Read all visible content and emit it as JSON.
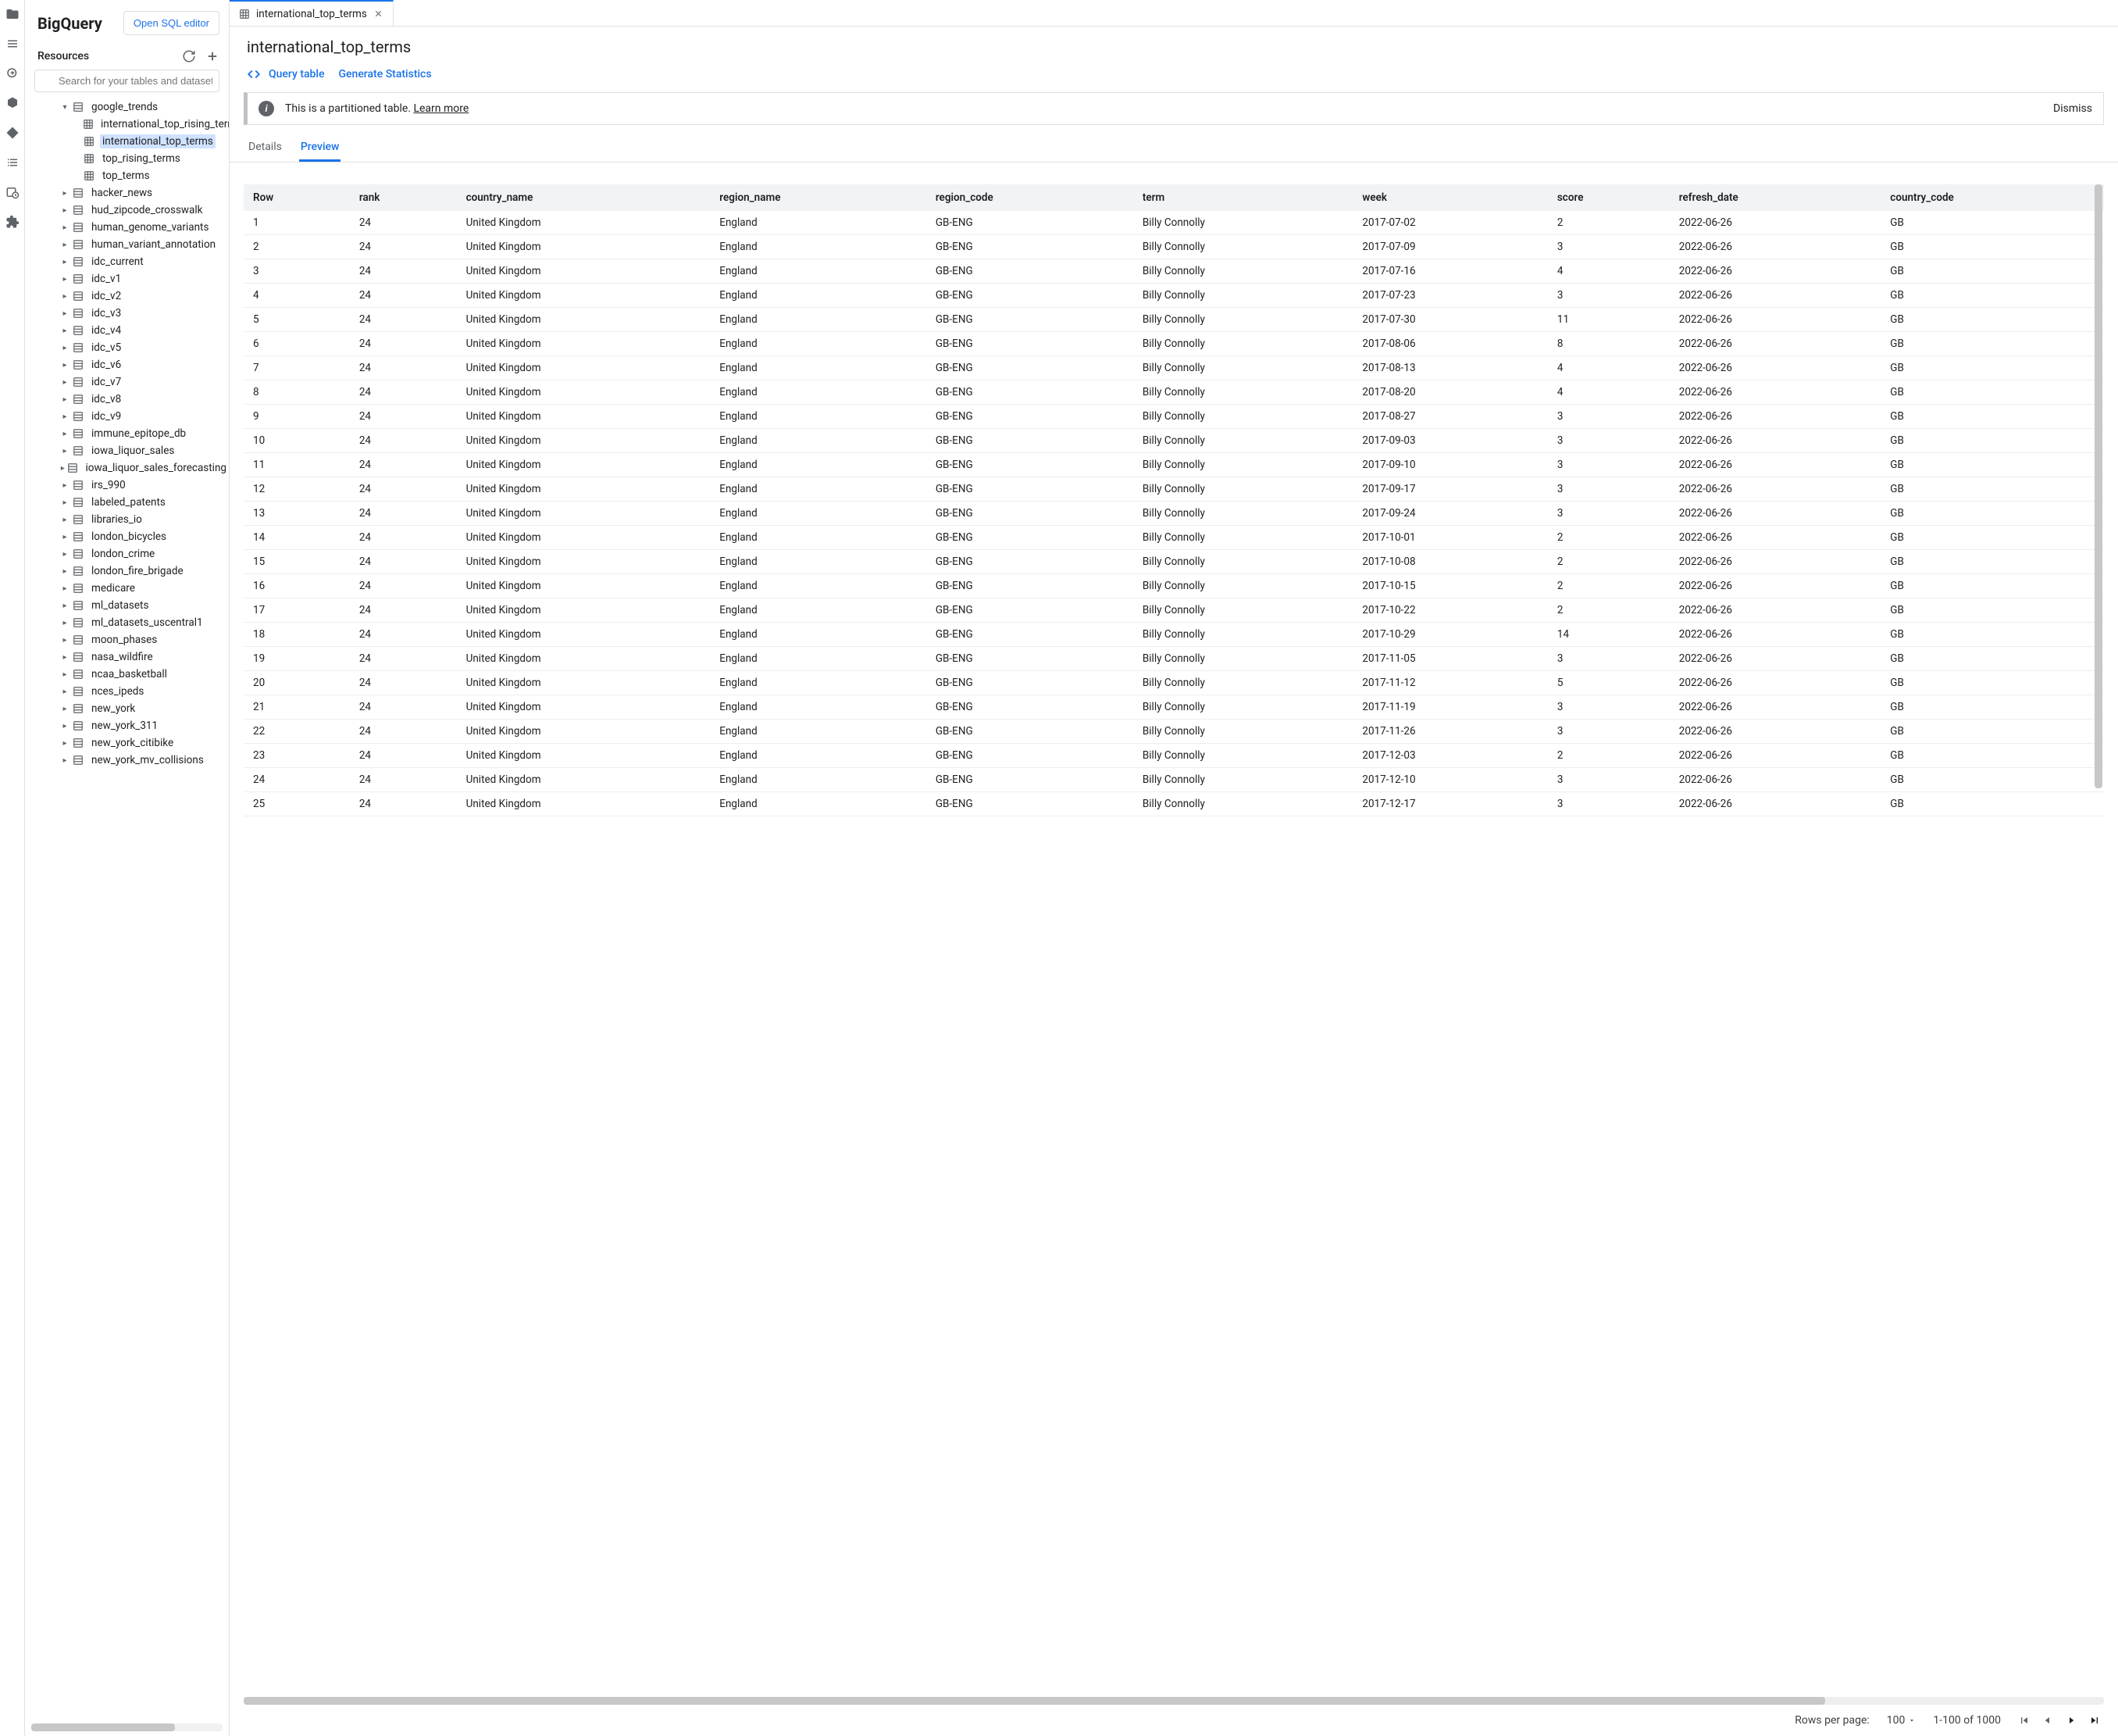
{
  "brand": "BigQuery",
  "open_sql_label": "Open SQL editor",
  "resources_label": "Resources",
  "search_placeholder": "Search for your tables and datasets",
  "tree": {
    "root": {
      "label": "google_trends",
      "children": [
        "international_top_rising_terms",
        "international_top_terms",
        "top_rising_terms",
        "top_terms"
      ],
      "selected_index": 1
    },
    "datasets": [
      "hacker_news",
      "hud_zipcode_crosswalk",
      "human_genome_variants",
      "human_variant_annotation",
      "idc_current",
      "idc_v1",
      "idc_v2",
      "idc_v3",
      "idc_v4",
      "idc_v5",
      "idc_v6",
      "idc_v7",
      "idc_v8",
      "idc_v9",
      "immune_epitope_db",
      "iowa_liquor_sales",
      "iowa_liquor_sales_forecasting",
      "irs_990",
      "labeled_patents",
      "libraries_io",
      "london_bicycles",
      "london_crime",
      "london_fire_brigade",
      "medicare",
      "ml_datasets",
      "ml_datasets_uscentral1",
      "moon_phases",
      "nasa_wildfire",
      "ncaa_basketball",
      "nces_ipeds",
      "new_york",
      "new_york_311",
      "new_york_citibike",
      "new_york_mv_collisions"
    ]
  },
  "tab": {
    "label": "international_top_terms"
  },
  "page_title": "international_top_terms",
  "actions": {
    "query_table": "Query table",
    "gen_stats": "Generate Statistics"
  },
  "banner": {
    "text": "This is a partitioned table. ",
    "link": "Learn more",
    "dismiss": "Dismiss"
  },
  "subtabs": {
    "details": "Details",
    "preview": "Preview"
  },
  "table": {
    "columns": [
      "Row",
      "rank",
      "country_name",
      "region_name",
      "region_code",
      "term",
      "week",
      "score",
      "refresh_date",
      "country_code"
    ],
    "rows": [
      [
        "1",
        "24",
        "United Kingdom",
        "England",
        "GB-ENG",
        "Billy Connolly",
        "2017-07-02",
        "2",
        "2022-06-26",
        "GB"
      ],
      [
        "2",
        "24",
        "United Kingdom",
        "England",
        "GB-ENG",
        "Billy Connolly",
        "2017-07-09",
        "3",
        "2022-06-26",
        "GB"
      ],
      [
        "3",
        "24",
        "United Kingdom",
        "England",
        "GB-ENG",
        "Billy Connolly",
        "2017-07-16",
        "4",
        "2022-06-26",
        "GB"
      ],
      [
        "4",
        "24",
        "United Kingdom",
        "England",
        "GB-ENG",
        "Billy Connolly",
        "2017-07-23",
        "3",
        "2022-06-26",
        "GB"
      ],
      [
        "5",
        "24",
        "United Kingdom",
        "England",
        "GB-ENG",
        "Billy Connolly",
        "2017-07-30",
        "11",
        "2022-06-26",
        "GB"
      ],
      [
        "6",
        "24",
        "United Kingdom",
        "England",
        "GB-ENG",
        "Billy Connolly",
        "2017-08-06",
        "8",
        "2022-06-26",
        "GB"
      ],
      [
        "7",
        "24",
        "United Kingdom",
        "England",
        "GB-ENG",
        "Billy Connolly",
        "2017-08-13",
        "4",
        "2022-06-26",
        "GB"
      ],
      [
        "8",
        "24",
        "United Kingdom",
        "England",
        "GB-ENG",
        "Billy Connolly",
        "2017-08-20",
        "4",
        "2022-06-26",
        "GB"
      ],
      [
        "9",
        "24",
        "United Kingdom",
        "England",
        "GB-ENG",
        "Billy Connolly",
        "2017-08-27",
        "3",
        "2022-06-26",
        "GB"
      ],
      [
        "10",
        "24",
        "United Kingdom",
        "England",
        "GB-ENG",
        "Billy Connolly",
        "2017-09-03",
        "3",
        "2022-06-26",
        "GB"
      ],
      [
        "11",
        "24",
        "United Kingdom",
        "England",
        "GB-ENG",
        "Billy Connolly",
        "2017-09-10",
        "3",
        "2022-06-26",
        "GB"
      ],
      [
        "12",
        "24",
        "United Kingdom",
        "England",
        "GB-ENG",
        "Billy Connolly",
        "2017-09-17",
        "3",
        "2022-06-26",
        "GB"
      ],
      [
        "13",
        "24",
        "United Kingdom",
        "England",
        "GB-ENG",
        "Billy Connolly",
        "2017-09-24",
        "3",
        "2022-06-26",
        "GB"
      ],
      [
        "14",
        "24",
        "United Kingdom",
        "England",
        "GB-ENG",
        "Billy Connolly",
        "2017-10-01",
        "2",
        "2022-06-26",
        "GB"
      ],
      [
        "15",
        "24",
        "United Kingdom",
        "England",
        "GB-ENG",
        "Billy Connolly",
        "2017-10-08",
        "2",
        "2022-06-26",
        "GB"
      ],
      [
        "16",
        "24",
        "United Kingdom",
        "England",
        "GB-ENG",
        "Billy Connolly",
        "2017-10-15",
        "2",
        "2022-06-26",
        "GB"
      ],
      [
        "17",
        "24",
        "United Kingdom",
        "England",
        "GB-ENG",
        "Billy Connolly",
        "2017-10-22",
        "2",
        "2022-06-26",
        "GB"
      ],
      [
        "18",
        "24",
        "United Kingdom",
        "England",
        "GB-ENG",
        "Billy Connolly",
        "2017-10-29",
        "14",
        "2022-06-26",
        "GB"
      ],
      [
        "19",
        "24",
        "United Kingdom",
        "England",
        "GB-ENG",
        "Billy Connolly",
        "2017-11-05",
        "3",
        "2022-06-26",
        "GB"
      ],
      [
        "20",
        "24",
        "United Kingdom",
        "England",
        "GB-ENG",
        "Billy Connolly",
        "2017-11-12",
        "5",
        "2022-06-26",
        "GB"
      ],
      [
        "21",
        "24",
        "United Kingdom",
        "England",
        "GB-ENG",
        "Billy Connolly",
        "2017-11-19",
        "3",
        "2022-06-26",
        "GB"
      ],
      [
        "22",
        "24",
        "United Kingdom",
        "England",
        "GB-ENG",
        "Billy Connolly",
        "2017-11-26",
        "3",
        "2022-06-26",
        "GB"
      ],
      [
        "23",
        "24",
        "United Kingdom",
        "England",
        "GB-ENG",
        "Billy Connolly",
        "2017-12-03",
        "2",
        "2022-06-26",
        "GB"
      ],
      [
        "24",
        "24",
        "United Kingdom",
        "England",
        "GB-ENG",
        "Billy Connolly",
        "2017-12-10",
        "3",
        "2022-06-26",
        "GB"
      ],
      [
        "25",
        "24",
        "United Kingdom",
        "England",
        "GB-ENG",
        "Billy Connolly",
        "2017-12-17",
        "3",
        "2022-06-26",
        "GB"
      ]
    ]
  },
  "footer": {
    "rpp_label": "Rows per page:",
    "rpp_value": "100",
    "range": "1-100 of 1000"
  }
}
